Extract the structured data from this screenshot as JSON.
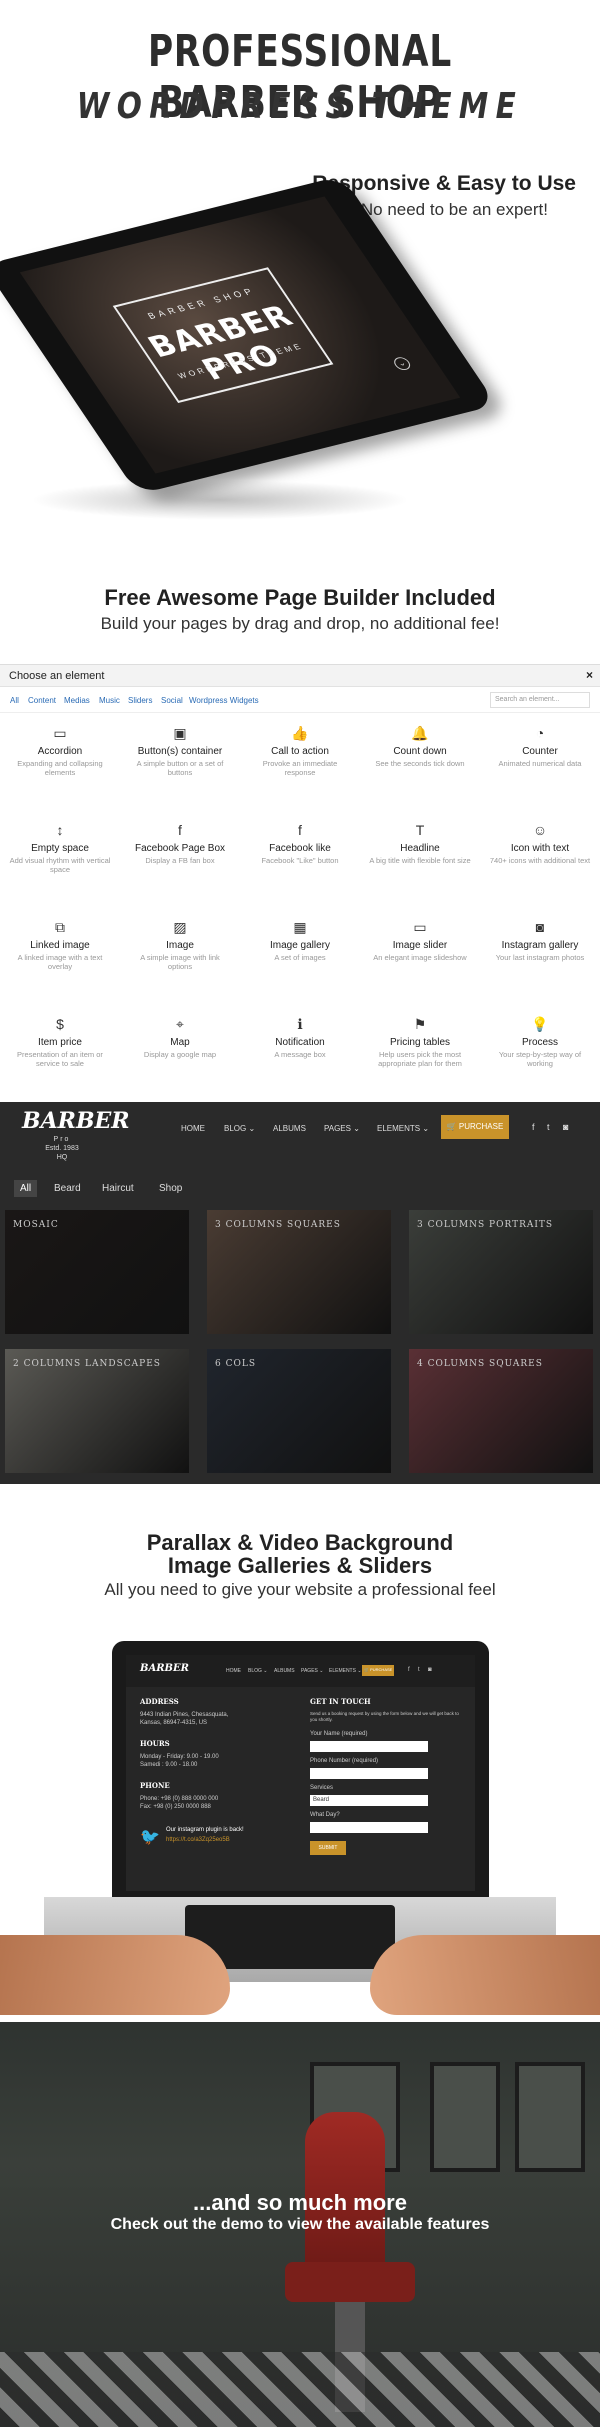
{
  "header": {
    "title": "PROFESSIONAL BARBER SHOP",
    "subtitle": "WORDPRESS THEME"
  },
  "responsive": {
    "title": "Responsive & Easy to Use",
    "subtitle": "No need to be an expert!"
  },
  "tablet": {
    "logo_top": "BARBER SHOP",
    "logo": "BARBER PRO",
    "logo_bottom": "WORDPRESS THEME"
  },
  "page_builder": {
    "title": "Free Awesome Page Builder Included",
    "subtitle": "Build your pages by drag and drop, no additional fee!",
    "dialog_title": "Choose an element",
    "close": "×",
    "tabs": [
      "All",
      "Content",
      "Medias",
      "Music",
      "Sliders",
      "Social",
      "Wordpress Widgets"
    ],
    "search_placeholder": "Search an element...",
    "items": [
      {
        "icon": "▭",
        "name": "Accordion",
        "desc": "Expanding and collapsing elements"
      },
      {
        "icon": "▣",
        "name": "Button(s) container",
        "desc": "A simple button or a set of buttons"
      },
      {
        "icon": "👍",
        "name": "Call to action",
        "desc": "Provoke an immediate response"
      },
      {
        "icon": "🔔",
        "name": "Count down",
        "desc": "See the seconds tick down"
      },
      {
        "icon": "◔",
        "name": "Counter",
        "desc": "Animated numerical data"
      },
      {
        "icon": "↕",
        "name": "Empty space",
        "desc": "Add visual rhythm with vertical space"
      },
      {
        "icon": "f",
        "name": "Facebook Page Box",
        "desc": "Display a FB fan box"
      },
      {
        "icon": "f",
        "name": "Facebook like",
        "desc": "Facebook \"Like\" button"
      },
      {
        "icon": "T",
        "name": "Headline",
        "desc": "A big title with flexible font size"
      },
      {
        "icon": "☺",
        "name": "Icon with text",
        "desc": "740+ icons with additional text"
      },
      {
        "icon": "⧉",
        "name": "Linked image",
        "desc": "A linked image with a text overlay"
      },
      {
        "icon": "▨",
        "name": "Image",
        "desc": "A simple image with link options"
      },
      {
        "icon": "▦",
        "name": "Image gallery",
        "desc": "A set of images"
      },
      {
        "icon": "▭",
        "name": "Image slider",
        "desc": "An elegant image slideshow"
      },
      {
        "icon": "◙",
        "name": "Instagram gallery",
        "desc": "Your last instagram photos"
      },
      {
        "icon": "$",
        "name": "Item price",
        "desc": "Presentation of an item or service to sale"
      },
      {
        "icon": "⌖",
        "name": "Map",
        "desc": "Display a google map"
      },
      {
        "icon": "ℹ",
        "name": "Notification",
        "desc": "A message box"
      },
      {
        "icon": "⚑",
        "name": "Pricing tables",
        "desc": "Help users pick the most appropriate plan for them"
      },
      {
        "icon": "💡",
        "name": "Process",
        "desc": "Your step-by-step way of working"
      }
    ]
  },
  "gallery": {
    "logo": "BARBER",
    "logo_sub": "Pro",
    "logo_est": "Estd. 1983",
    "logo_hq": "HQ",
    "menu": [
      "HOME",
      "BLOG ⌄",
      "ALBUMS",
      "PAGES ⌄",
      "ELEMENTS ⌄"
    ],
    "purchase": "🛒 PURCHASE",
    "social": [
      "f",
      "t",
      "◙"
    ],
    "filters": [
      "All",
      "Beard",
      "Haircut",
      "Shop"
    ],
    "tiles": [
      {
        "label": "MOSAIC",
        "color": "#1a1716"
      },
      {
        "label": "3 COLUMNS SQUARES",
        "color": "#4a3c33"
      },
      {
        "label": "3 COLUMNS PORTRAITS",
        "color": "#3b3e3a"
      },
      {
        "label": "2 COLUMNS LANDSCAPES",
        "color": "#5b5a55"
      },
      {
        "label": "6 COLS",
        "color": "#20252d"
      },
      {
        "label": "4 COLUMNS SQUARES",
        "color": "#5a3035"
      }
    ]
  },
  "parallax": {
    "line1": "Parallax & Video Background",
    "line2": "Image Galleries & Sliders",
    "line3": "All you need to give your website a professional feel"
  },
  "laptop": {
    "address_h": "ADDRESS",
    "address": [
      "9443 Indian Pines, Chesasquata,",
      "Kansas, 86947-4315, US"
    ],
    "hours_h": "HOURS",
    "hours": [
      "Monday - Friday: 9.00 - 19.00",
      "Samedi : 9.00 - 18.00"
    ],
    "phone_h": "PHONE",
    "phone": [
      "Phone: +98 (0) 888 0000 000",
      "Fax: +98 (0) 250 0000 888"
    ],
    "instagram": "Our instagram plugin is back!",
    "instagram_link": "https://t.co/a3Zq25eo5B",
    "contact_h": "GET IN TOUCH",
    "contact_intro": "Send us a booking request by using the form below and we will get back to you shortly.",
    "f_name": "Your Name (required)",
    "f_phone": "Phone Number (required)",
    "f_services": "Services",
    "f_services_val": "Beard",
    "f_day": "What Day?",
    "submit": "SUBMIT"
  },
  "bottom": {
    "line1": "...and so much more",
    "line2": "Check out the demo to view the available features"
  },
  "colors": {
    "accent": "#c9932a",
    "link": "#2a6bb5",
    "dark": "#2a2a2a"
  }
}
